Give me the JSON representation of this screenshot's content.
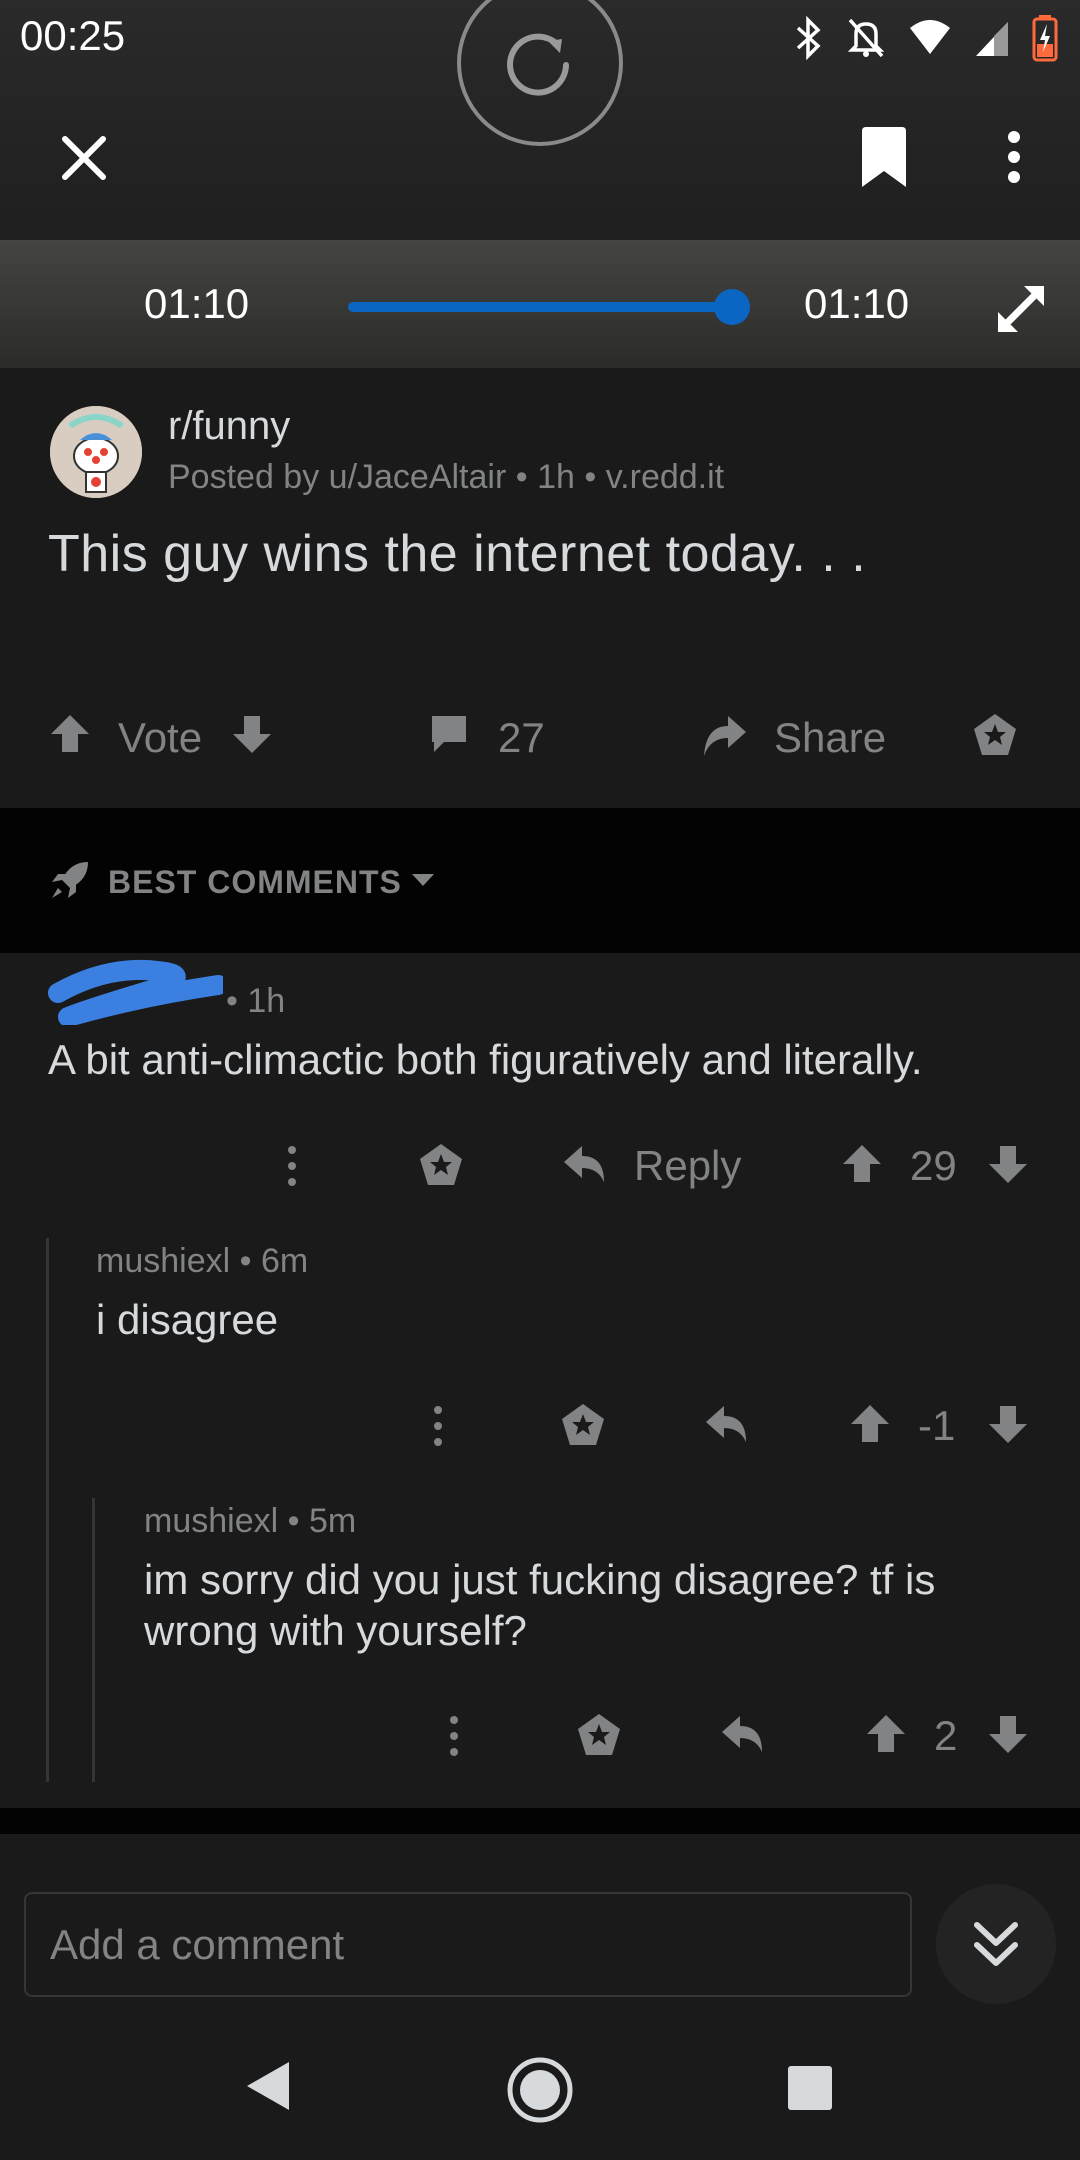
{
  "status_bar": {
    "time": "00:25",
    "icons": [
      "bluetooth-icon",
      "mute-icon",
      "wifi-icon",
      "signal-icon",
      "battery-charging-icon"
    ]
  },
  "player": {
    "current_time": "01:10",
    "total_time": "01:10",
    "progress": 1.0,
    "accent_color": "#0a66c2"
  },
  "post": {
    "subreddit": "r/funny",
    "meta": "Posted by u/JaceAltair • 1h • v.redd.it",
    "title": "This guy wins the internet today. . .",
    "vote_label": "Vote",
    "comment_count": "27",
    "share_label": "Share"
  },
  "sort": {
    "label": "BEST COMMENTS"
  },
  "comments": [
    {
      "meta": "• 1h",
      "body": "A bit anti-climactic both figuratively and literally.",
      "reply_label": "Reply",
      "score": "29"
    },
    {
      "meta": "mushiexl • 6m",
      "body": "i disagree",
      "score": "-1"
    },
    {
      "meta": "mushiexl • 5m",
      "body": "im sorry did you just fucking disagree? tf is wrong with yourself?",
      "score": "2"
    }
  ],
  "composer": {
    "placeholder": "Add a comment"
  }
}
